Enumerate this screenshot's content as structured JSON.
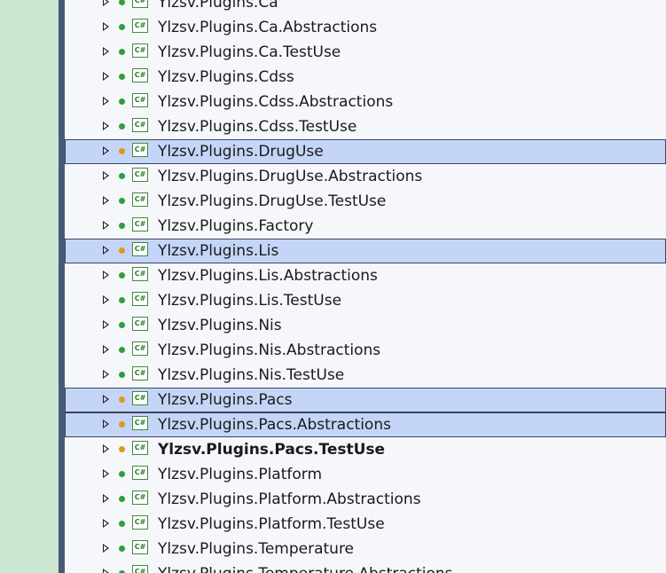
{
  "solution_explorer": {
    "project_icon_text": "C#",
    "status_colors": {
      "green": "#2e9e3e",
      "orange": "#e3961c"
    },
    "projects": [
      {
        "name": "Ylzsv.Plugins.Ca",
        "status": "green",
        "selected": false,
        "bold": false
      },
      {
        "name": "Ylzsv.Plugins.Ca.Abstractions",
        "status": "green",
        "selected": false,
        "bold": false
      },
      {
        "name": "Ylzsv.Plugins.Ca.TestUse",
        "status": "green",
        "selected": false,
        "bold": false
      },
      {
        "name": "Ylzsv.Plugins.Cdss",
        "status": "green",
        "selected": false,
        "bold": false
      },
      {
        "name": "Ylzsv.Plugins.Cdss.Abstractions",
        "status": "green",
        "selected": false,
        "bold": false
      },
      {
        "name": "Ylzsv.Plugins.Cdss.TestUse",
        "status": "green",
        "selected": false,
        "bold": false
      },
      {
        "name": "Ylzsv.Plugins.DrugUse",
        "status": "orange",
        "selected": true,
        "bold": false
      },
      {
        "name": "Ylzsv.Plugins.DrugUse.Abstractions",
        "status": "green",
        "selected": false,
        "bold": false
      },
      {
        "name": "Ylzsv.Plugins.DrugUse.TestUse",
        "status": "green",
        "selected": false,
        "bold": false
      },
      {
        "name": "Ylzsv.Plugins.Factory",
        "status": "green",
        "selected": false,
        "bold": false
      },
      {
        "name": "Ylzsv.Plugins.Lis",
        "status": "orange",
        "selected": true,
        "bold": false
      },
      {
        "name": "Ylzsv.Plugins.Lis.Abstractions",
        "status": "green",
        "selected": false,
        "bold": false
      },
      {
        "name": "Ylzsv.Plugins.Lis.TestUse",
        "status": "green",
        "selected": false,
        "bold": false
      },
      {
        "name": "Ylzsv.Plugins.Nis",
        "status": "green",
        "selected": false,
        "bold": false
      },
      {
        "name": "Ylzsv.Plugins.Nis.Abstractions",
        "status": "green",
        "selected": false,
        "bold": false
      },
      {
        "name": "Ylzsv.Plugins.Nis.TestUse",
        "status": "green",
        "selected": false,
        "bold": false
      },
      {
        "name": "Ylzsv.Plugins.Pacs",
        "status": "orange",
        "selected": true,
        "bold": false
      },
      {
        "name": "Ylzsv.Plugins.Pacs.Abstractions",
        "status": "orange",
        "selected": true,
        "bold": false
      },
      {
        "name": "Ylzsv.Plugins.Pacs.TestUse",
        "status": "orange",
        "selected": false,
        "bold": true
      },
      {
        "name": "Ylzsv.Plugins.Platform",
        "status": "green",
        "selected": false,
        "bold": false
      },
      {
        "name": "Ylzsv.Plugins.Platform.Abstractions",
        "status": "green",
        "selected": false,
        "bold": false
      },
      {
        "name": "Ylzsv.Plugins.Platform.TestUse",
        "status": "green",
        "selected": false,
        "bold": false
      },
      {
        "name": "Ylzsv.Plugins.Temperature",
        "status": "green",
        "selected": false,
        "bold": false
      },
      {
        "name": "Ylzsv.Plugins.Temperature.Abstractions",
        "status": "green",
        "selected": false,
        "bold": false
      }
    ]
  }
}
